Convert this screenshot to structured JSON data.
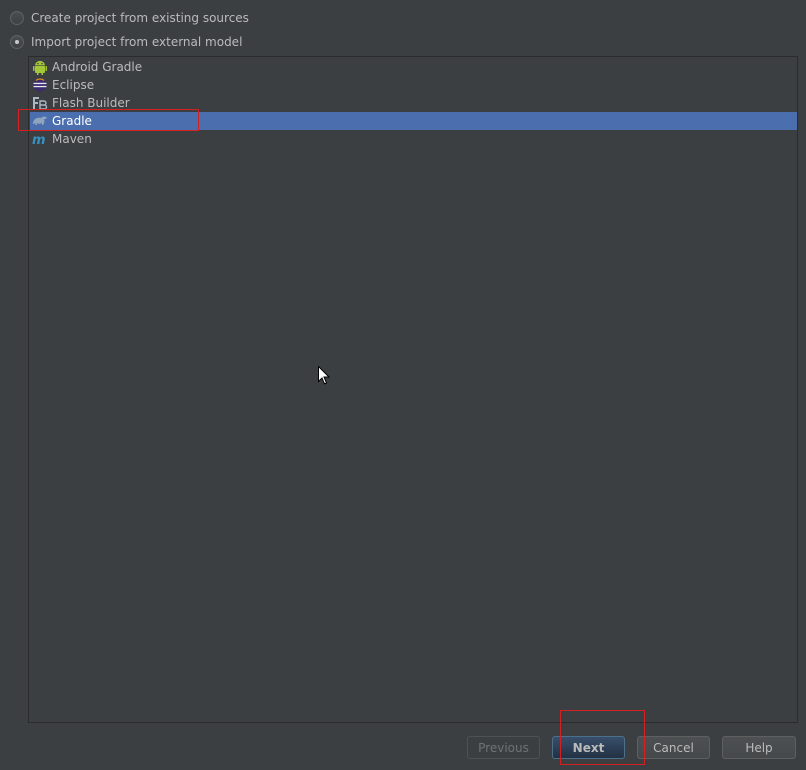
{
  "options": {
    "create_from_sources": "Create project from existing sources",
    "import_from_model": "Import project from external model",
    "selected": "import_from_model"
  },
  "models": [
    {
      "label": "Android Gradle",
      "icon": "android-icon",
      "selected": false
    },
    {
      "label": "Eclipse",
      "icon": "eclipse-icon",
      "selected": false
    },
    {
      "label": "Flash Builder",
      "icon": "flash-builder-icon",
      "selected": false
    },
    {
      "label": "Gradle",
      "icon": "gradle-icon",
      "selected": true
    },
    {
      "label": "Maven",
      "icon": "maven-icon",
      "selected": false
    }
  ],
  "buttons": {
    "previous": "Previous",
    "next": "Next",
    "cancel": "Cancel",
    "help": "Help"
  },
  "colors": {
    "background": "#3c3f41",
    "selection": "#4b6eaf",
    "highlight_box": "#d42020",
    "default_button": "#2f4057"
  }
}
